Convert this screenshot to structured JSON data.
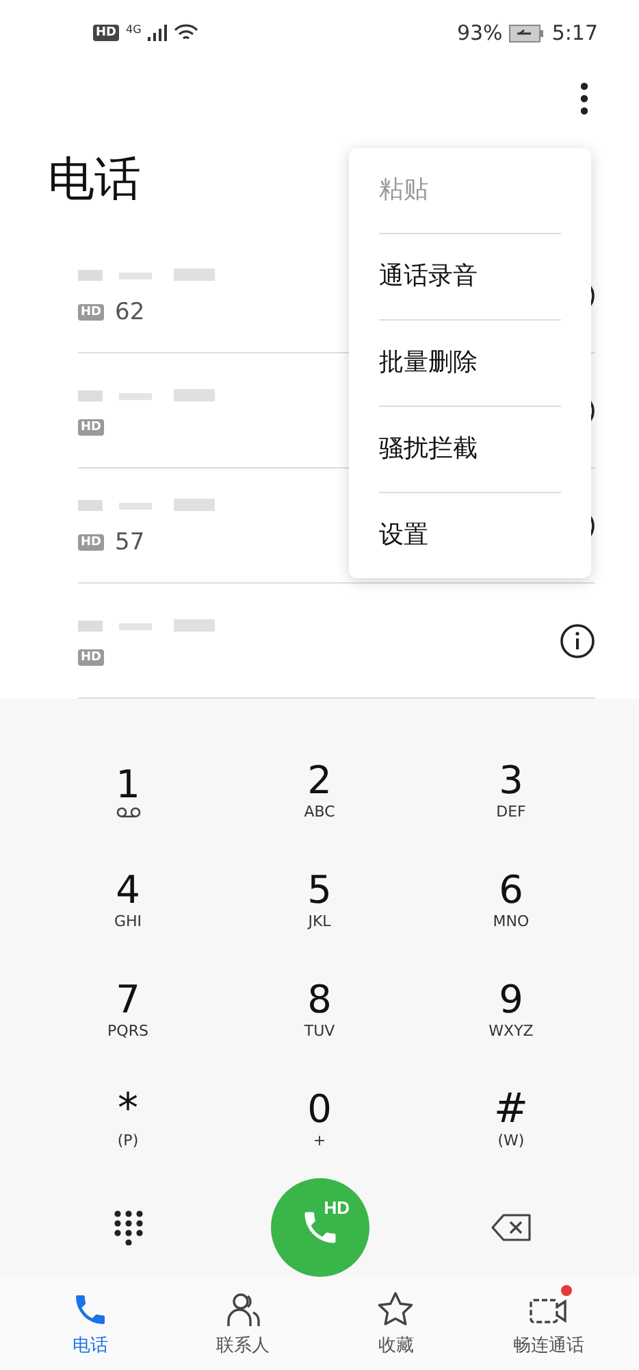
{
  "status_bar": {
    "hd": "HD",
    "network": "4G",
    "battery": "93%",
    "time": "5:17"
  },
  "title": "电话",
  "contacts": [
    {
      "hd": "HD",
      "number": "62"
    },
    {
      "hd": "HD"
    },
    {
      "hd": "HD",
      "number": "57"
    },
    {
      "hd": "HD"
    }
  ],
  "menu": [
    {
      "label": "粘贴",
      "disabled": true
    },
    {
      "label": "通话录音",
      "disabled": false
    },
    {
      "label": "批量删除",
      "disabled": false
    },
    {
      "label": "骚扰拦截",
      "disabled": false
    },
    {
      "label": "设置",
      "disabled": false
    }
  ],
  "keys": [
    {
      "digit": "1",
      "kind": "voicemail"
    },
    {
      "digit": "2",
      "letters": "ABC"
    },
    {
      "digit": "3",
      "letters": "DEF"
    },
    {
      "digit": "4",
      "letters": "GHI"
    },
    {
      "digit": "5",
      "letters": "JKL"
    },
    {
      "digit": "6",
      "letters": "MNO"
    },
    {
      "digit": "7",
      "letters": "PQRS"
    },
    {
      "digit": "8",
      "letters": "TUV"
    },
    {
      "digit": "9",
      "letters": "WXYZ"
    },
    {
      "digit": "*",
      "letters": "(P)"
    },
    {
      "digit": "0",
      "letters": "+"
    },
    {
      "digit": "#",
      "letters": "(W)"
    }
  ],
  "call_button": "HD",
  "nav": [
    {
      "label": "电话",
      "selected": true,
      "badge": false
    },
    {
      "label": "联系人",
      "selected": false,
      "badge": false
    },
    {
      "label": "收藏",
      "selected": false,
      "badge": false
    },
    {
      "label": "畅连通话",
      "selected": false,
      "badge": true
    }
  ]
}
